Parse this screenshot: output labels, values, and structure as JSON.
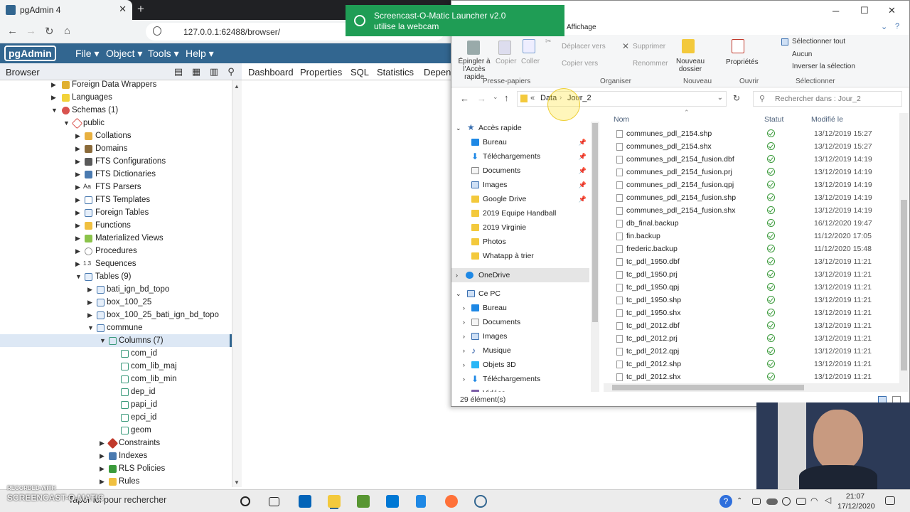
{
  "browser": {
    "tab_title": "pgAdmin 4",
    "url": "127.0.0.1:62488/browser/"
  },
  "pgadmin": {
    "logo": "pgAdmin",
    "menus": [
      "File",
      "Object",
      "Tools",
      "Help"
    ],
    "browser_title": "Browser",
    "panel_tabs": [
      "Dashboard",
      "Properties",
      "SQL",
      "Statistics",
      "Depend"
    ],
    "tree": [
      {
        "label": "Foreign Data Wrappers"
      },
      {
        "label": "Languages"
      },
      {
        "label": "Schemas (1)"
      },
      {
        "label": "public"
      },
      {
        "label": "Collations"
      },
      {
        "label": "Domains"
      },
      {
        "label": "FTS Configurations"
      },
      {
        "label": "FTS Dictionaries"
      },
      {
        "label": "FTS Parsers"
      },
      {
        "label": "FTS Templates"
      },
      {
        "label": "Foreign Tables"
      },
      {
        "label": "Functions"
      },
      {
        "label": "Materialized Views"
      },
      {
        "label": "Procedures"
      },
      {
        "label": "Sequences"
      },
      {
        "label": "Tables (9)"
      },
      {
        "label": "bati_ign_bd_topo"
      },
      {
        "label": "box_100_25"
      },
      {
        "label": "box_100_25_bati_ign_bd_topo"
      },
      {
        "label": "commune"
      },
      {
        "label": "Columns (7)"
      },
      {
        "label": "com_id"
      },
      {
        "label": "com_lib_maj"
      },
      {
        "label": "com_lib_min"
      },
      {
        "label": "dep_id"
      },
      {
        "label": "papi_id"
      },
      {
        "label": "epci_id"
      },
      {
        "label": "geom"
      },
      {
        "label": "Constraints"
      },
      {
        "label": "Indexes"
      },
      {
        "label": "RLS Policies"
      },
      {
        "label": "Rules"
      }
    ]
  },
  "toast": {
    "line1": "Screencast-O-Matic Launcher v2.0",
    "line2": "utilise la webcam"
  },
  "explorer": {
    "ribbon_tab": "Affichage",
    "ribbon": {
      "pin": "Épingler à l'Accès rapide",
      "copy": "Copier",
      "paste": "Coller",
      "move_to": "Déplacer vers",
      "copy_to": "Copier vers",
      "delete": "Supprimer",
      "rename": "Renommer",
      "new_folder": "Nouveau dossier",
      "properties": "Propriétés",
      "select_all": "Sélectionner tout",
      "select_none": "Aucun",
      "invert": "Inverser la sélection",
      "groups": [
        "Presse-papiers",
        "Organiser",
        "Nouveau",
        "Ouvrir",
        "Sélectionner"
      ]
    },
    "path": [
      "«",
      "Data",
      "Jour_2"
    ],
    "search_placeholder": "Rechercher dans : Jour_2",
    "nav": [
      {
        "label": "Accès rapide"
      },
      {
        "label": "Bureau"
      },
      {
        "label": "Téléchargements"
      },
      {
        "label": "Documents"
      },
      {
        "label": "Images"
      },
      {
        "label": "Google Drive"
      },
      {
        "label": "2019 Equipe Handball"
      },
      {
        "label": "2019 Virginie"
      },
      {
        "label": "Photos"
      },
      {
        "label": "Whatapp à trier"
      },
      {
        "label": "OneDrive"
      },
      {
        "label": "Ce PC"
      },
      {
        "label": "Bureau"
      },
      {
        "label": "Documents"
      },
      {
        "label": "Images"
      },
      {
        "label": "Musique"
      },
      {
        "label": "Objets 3D"
      },
      {
        "label": "Téléchargements"
      },
      {
        "label": "Vidéos"
      }
    ],
    "columns": [
      "Nom",
      "Statut",
      "Modifié le"
    ],
    "files": [
      {
        "name": "communes_pdl_2154.shp",
        "date": "13/12/2019 15:27"
      },
      {
        "name": "communes_pdl_2154.shx",
        "date": "13/12/2019 15:27"
      },
      {
        "name": "communes_pdl_2154_fusion.dbf",
        "date": "13/12/2019 14:19"
      },
      {
        "name": "communes_pdl_2154_fusion.prj",
        "date": "13/12/2019 14:19"
      },
      {
        "name": "communes_pdl_2154_fusion.qpj",
        "date": "13/12/2019 14:19"
      },
      {
        "name": "communes_pdl_2154_fusion.shp",
        "date": "13/12/2019 14:19"
      },
      {
        "name": "communes_pdl_2154_fusion.shx",
        "date": "13/12/2019 14:19"
      },
      {
        "name": "db_final.backup",
        "date": "16/12/2020 19:47"
      },
      {
        "name": "fin.backup",
        "date": "11/12/2020 17:05"
      },
      {
        "name": "frederic.backup",
        "date": "11/12/2020 15:48"
      },
      {
        "name": "tc_pdl_1950.dbf",
        "date": "13/12/2019 11:21"
      },
      {
        "name": "tc_pdl_1950.prj",
        "date": "13/12/2019 11:21"
      },
      {
        "name": "tc_pdl_1950.qpj",
        "date": "13/12/2019 11:21"
      },
      {
        "name": "tc_pdl_1950.shp",
        "date": "13/12/2019 11:21"
      },
      {
        "name": "tc_pdl_1950.shx",
        "date": "13/12/2019 11:21"
      },
      {
        "name": "tc_pdl_2012.dbf",
        "date": "13/12/2019 11:21"
      },
      {
        "name": "tc_pdl_2012.prj",
        "date": "13/12/2019 11:21"
      },
      {
        "name": "tc_pdl_2012.qpj",
        "date": "13/12/2019 11:21"
      },
      {
        "name": "tc_pdl_2012.shp",
        "date": "13/12/2019 11:21"
      },
      {
        "name": "tc_pdl_2012.shx",
        "date": "13/12/2019 11:21"
      }
    ],
    "status": "29 élément(s)"
  },
  "taskbar": {
    "search": "Taper ici pour rechercher",
    "time": "21:07",
    "date": "17/12/2020"
  },
  "watermark": {
    "recorded": "RECORDED WITH",
    "brand": "SCREENCAST-O-MATIC"
  },
  "colors": {
    "pgadmin_blue": "#326690",
    "toast_green": "#1f9d55",
    "status_ok": "#3a9a3a"
  }
}
